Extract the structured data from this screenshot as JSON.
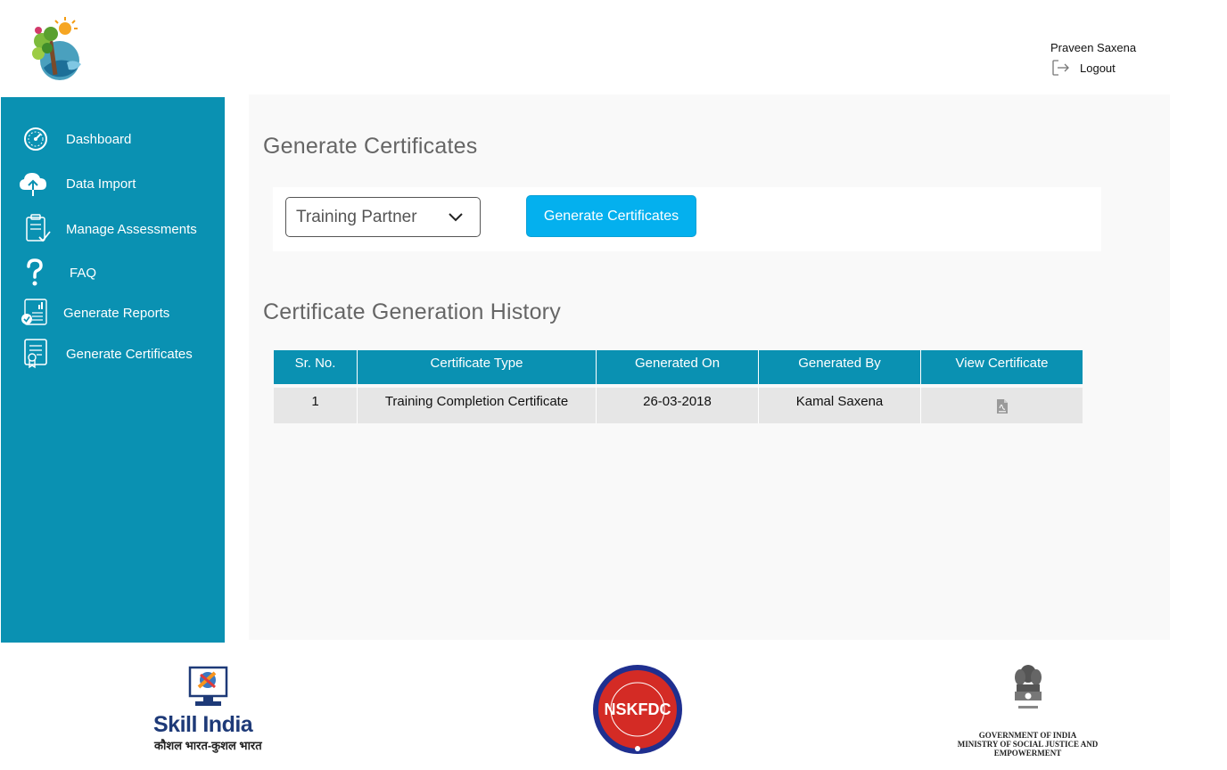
{
  "header": {
    "user_name": "Praveen Saxena",
    "logout_label": "Logout"
  },
  "sidebar": {
    "items": [
      {
        "label": "Dashboard",
        "icon": "speedometer-icon"
      },
      {
        "label": "Data Import",
        "icon": "cloud-upload-icon"
      },
      {
        "label": "Manage Assessments",
        "icon": "clipboard-check-icon"
      },
      {
        "label": "FAQ",
        "icon": "question-mark-icon"
      },
      {
        "label": "Generate Reports",
        "icon": "report-chart-icon"
      },
      {
        "label": "Generate Certificates",
        "icon": "certificate-icon"
      }
    ]
  },
  "main": {
    "title": "Generate Certificates",
    "select_value": "Training Partner",
    "generate_button": "Generate Certificates",
    "history_title": "Certificate Generation History",
    "table": {
      "columns": [
        "Sr. No.",
        "Certificate Type",
        "Generated On",
        "Generated By",
        "View Certificate"
      ],
      "rows": [
        {
          "sr": "1",
          "type": "Training Completion Certificate",
          "date": "26-03-2018",
          "by": "Kamal Saxena",
          "view_icon": "pdf-file-icon"
        }
      ]
    }
  },
  "footer": {
    "skill_india": "Skill India",
    "skill_india_sub": "कौशल भारत-कुशल भारत",
    "gov_line1": "GOVERNMENT OF INDIA",
    "gov_line2": "MINISTRY OF SOCIAL JUSTICE AND",
    "gov_line3": "EMPOWERMENT",
    "nskfdc_text": "NSKFDC"
  },
  "colors": {
    "sidebar": "#0a91b2",
    "accent_button": "#04b0ee",
    "table_header": "#0a91b2",
    "table_row": "#e6e6e6",
    "panel": "#f9f9f9"
  }
}
